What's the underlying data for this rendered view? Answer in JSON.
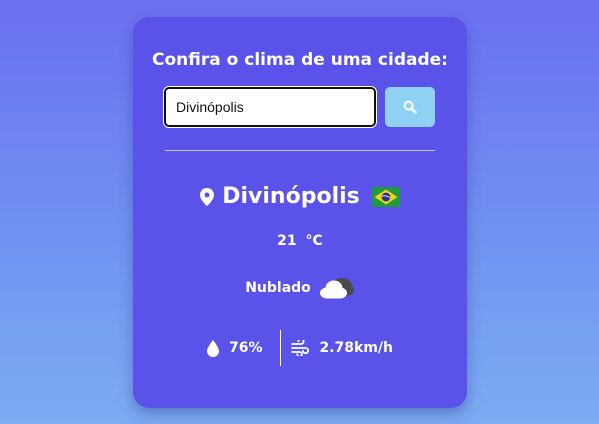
{
  "heading": "Confira o clima de uma cidade:",
  "search": {
    "value": "Divinópolis",
    "button_icon": "search-icon"
  },
  "weather": {
    "city": "Divinópolis",
    "country_flag": "brazil-flag-icon",
    "temperature": "21 °C",
    "description": "Nublado",
    "condition_icon": "cloud-icon",
    "humidity": "76%",
    "wind": "2.78km/h"
  },
  "colors": {
    "background_top": "#6a6ff0",
    "background_bottom": "#7cacf2",
    "card": "#5b52e9",
    "search_button": "#8fd0f5",
    "text": "#ffffff"
  }
}
